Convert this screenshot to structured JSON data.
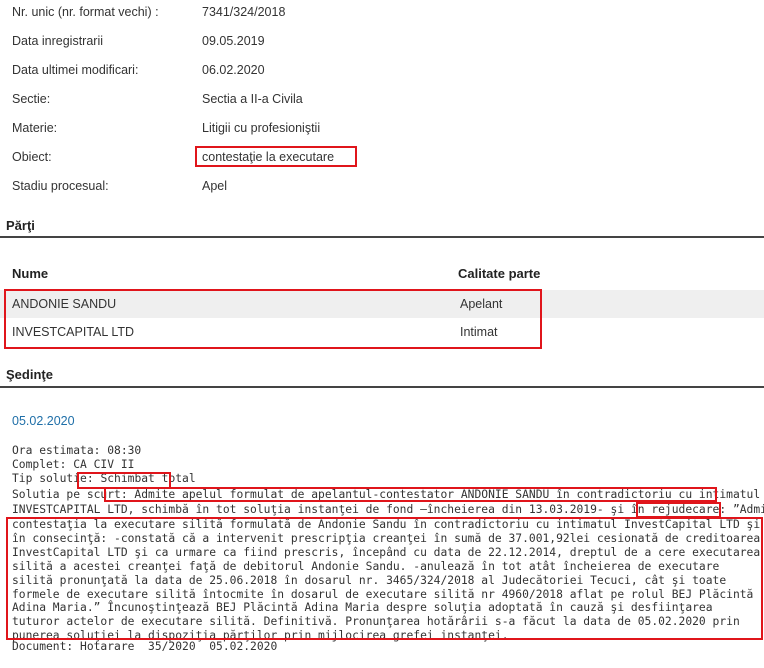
{
  "info": [
    {
      "label": "Nr. unic (nr. format vechi) :",
      "value": "7341/324/2018"
    },
    {
      "label": "Data inregistrarii",
      "value": "09.05.2019"
    },
    {
      "label": "Data ultimei modificari:",
      "value": "06.02.2020"
    },
    {
      "label": "Sectie:",
      "value": "Sectia a II-a Civila"
    },
    {
      "label": "Materie:",
      "value": "Litigii cu profesioniştii"
    },
    {
      "label": "Obiect:",
      "value": "contestaţie la executare"
    },
    {
      "label": "Stadiu procesual:",
      "value": "Apel"
    }
  ],
  "parti": {
    "heading": "Părţi",
    "col_name": "Nume",
    "col_role": "Calitate parte",
    "rows": [
      {
        "name": "ANDONIE SANDU",
        "role": "Apelant"
      },
      {
        "name": "INVESTCAPITAL LTD",
        "role": "Intimat"
      }
    ]
  },
  "sedinte": {
    "heading": "Şedinţe",
    "date": "05.02.2020",
    "ora": "Ora estimata: 08:30",
    "complet": "Complet: CA CIV II",
    "tip_label": "Tip solutie:",
    "tip_value": "Schimbat total",
    "solutie_line1": "Solutia pe scurt: Admite apelul formulat de apelantul-contestator ANDONIE SANDU în contradictoriu cu intimatul",
    "solutie_line2": "INVESTCAPITAL LTD, schimbă în tot soluţia instanţei de fond –încheierea din 13.03.2019- şi în rejudecare: ”Admite",
    "solutie_rest": "contestaţia la executare silită formulată de Andonie Sandu în contradictoriu cu intimatul InvestCapital LTD şi în consecinţă: -constată că a intervenit prescripţia creanţei în sumă de 37.001,92lei cesionată de creditoarea InvestCapital LTD şi ca urmare ca fiind prescris, începând cu data de 22.12.2014, dreptul de a cere executarea silită a acestei creanţei faţă de debitorul Andonie Sandu. -anulează în tot atât încheierea de executare silită pronunţată la data de 25.06.2018 în dosarul nr. 3465/324/2018 al Judecătoriei Tecuci, cât şi toate formele de executare silită întocmite în dosarul de executare silită nr 4960/2018 aflat pe rolul BEJ Plăcintă Adina Maria.” Încunoştinţează BEJ Plăcintă Adina Maria despre soluţia adoptată în cauză şi desfiinţarea tuturor actelor de executare silită. Definitivă. Pronunţarea hotărârii s-a făcut la data de 05.02.2020 prin punerea soluţiei la dispoziţia părţilor prin mijlocirea grefei instanţei.",
    "document": "Document: Hotarare  35/2020  05.02.2020"
  },
  "colors": {
    "highlight": "#e0151b",
    "link_date": "#1f6fa8",
    "stripe": "#efefef"
  }
}
